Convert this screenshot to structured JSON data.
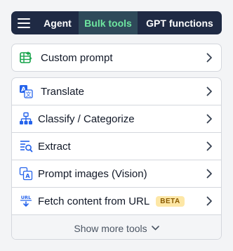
{
  "topbar": {
    "menu_icon": "hamburger-menu-icon",
    "tabs": [
      {
        "label": "Agent",
        "active": false
      },
      {
        "label": "Bulk tools",
        "active": true
      },
      {
        "label": "GPT functions",
        "active": false
      }
    ]
  },
  "custom_prompt": {
    "label": "Custom prompt",
    "icon": "spreadsheet-sparkle-icon"
  },
  "tools": [
    {
      "label": "Translate",
      "icon": "translate-icon"
    },
    {
      "label": "Classify / Categorize",
      "icon": "hierarchy-icon"
    },
    {
      "label": "Extract",
      "icon": "extract-search-icon"
    },
    {
      "label": "Prompt images (Vision)",
      "icon": "image-prompt-icon"
    },
    {
      "label": "Fetch content from URL",
      "icon": "url-download-icon",
      "badge": "BETA"
    }
  ],
  "show_more": {
    "label": "Show more tools"
  },
  "colors": {
    "nav_bg": "#1f2a44",
    "active_tab_bg": "#2f4a5a",
    "active_tab_text": "#6ee7a0",
    "icon_blue": "#2563eb",
    "icon_green": "#16a34a",
    "badge_bg": "#fde7a6"
  }
}
